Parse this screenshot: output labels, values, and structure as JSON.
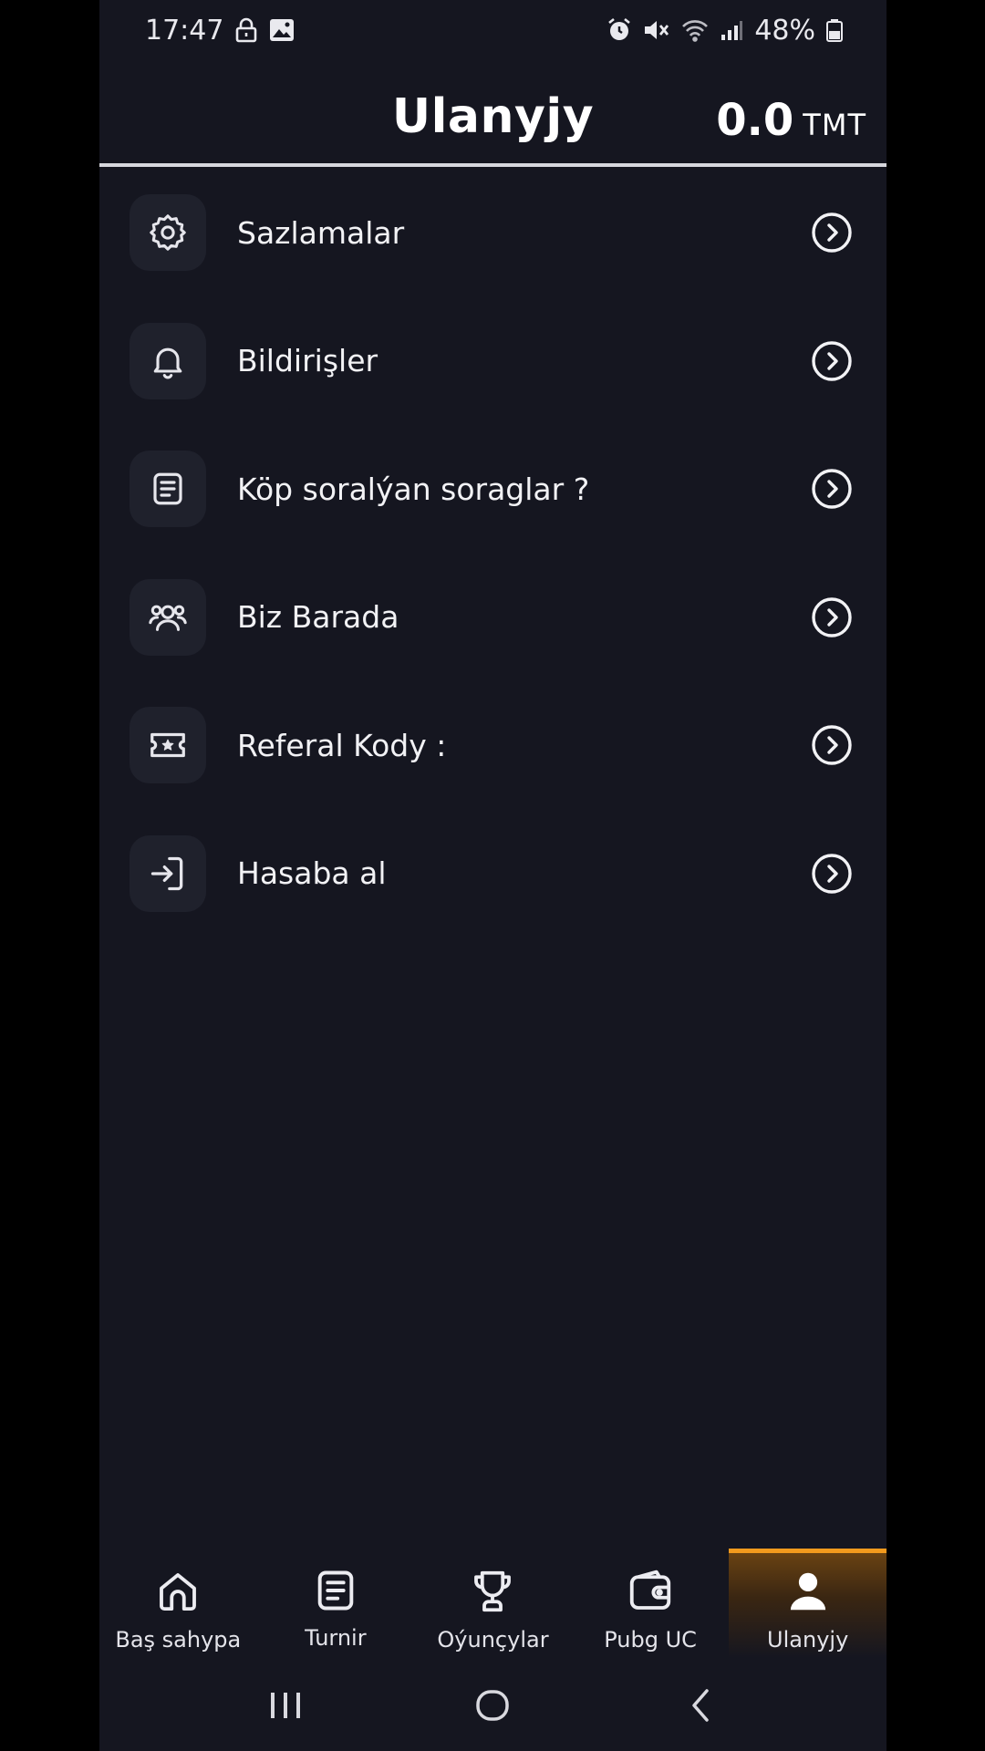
{
  "status_bar": {
    "time": "17:47",
    "battery": "48%"
  },
  "header": {
    "title": "Ulanyjy",
    "balance_value": "0.0",
    "balance_currency": "TMT"
  },
  "menu": {
    "items": [
      {
        "label": "Sazlamalar",
        "icon": "gear-icon"
      },
      {
        "label": "Bildirişler",
        "icon": "bell-icon"
      },
      {
        "label": "Köp soralýan soraglar ?",
        "icon": "document-icon"
      },
      {
        "label": "Biz Barada",
        "icon": "users-icon"
      },
      {
        "label": "Referal Kody :",
        "icon": "ticket-icon"
      },
      {
        "label": "Hasaba al",
        "icon": "login-icon"
      }
    ]
  },
  "bottom_nav": {
    "items": [
      {
        "label": "Baş sahypa",
        "icon": "home-icon"
      },
      {
        "label": "Turnir",
        "icon": "document-icon"
      },
      {
        "label": "Oýunçylar",
        "icon": "trophy-icon"
      },
      {
        "label": "Pubg UC",
        "icon": "wallet-icon"
      },
      {
        "label": "Ulanyjy",
        "icon": "user-icon",
        "active": true
      }
    ]
  },
  "colors": {
    "background": "#151620",
    "icon_box": "#1f212c",
    "accent": "#f39a1d"
  }
}
